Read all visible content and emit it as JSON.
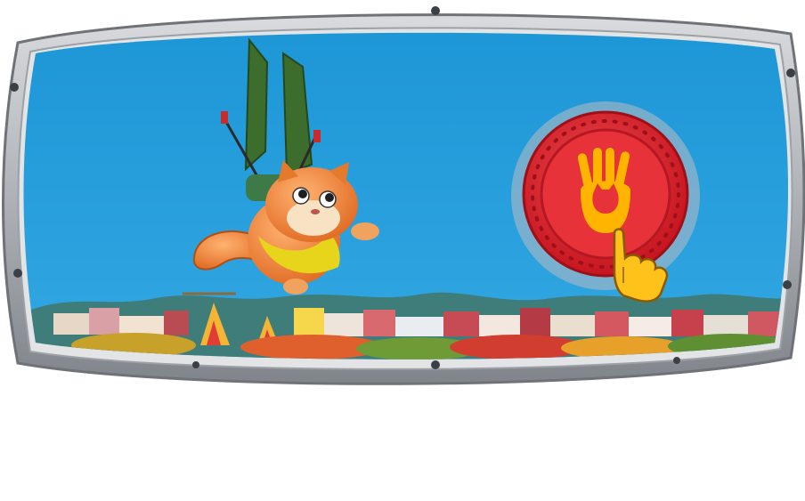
{
  "scene": {
    "frame": {
      "kind": "porthole-window",
      "material": "brushed-metal",
      "bolt_count": 8
    },
    "sky_color": "#1e9ad9",
    "character": {
      "name": "orange-cat",
      "action": "gliding",
      "gear": "green-wing-glider"
    },
    "background": "colorful-town-skyline",
    "action_button": {
      "icon": "cat-paw-icon",
      "hint": "tapping-hand-icon",
      "colors": {
        "outer": "#c9141f",
        "inner": "#e8323a",
        "icon": "#ffb400"
      }
    }
  },
  "colors": {
    "frame_outer": "#6f7277",
    "frame_mid": "#b9bcc1",
    "frame_inner": "#e2e4e6",
    "sky": "#1e9ad9",
    "hills": "#3f7d7a",
    "button_red": "#e12a31",
    "paw_yellow": "#ffb400"
  }
}
